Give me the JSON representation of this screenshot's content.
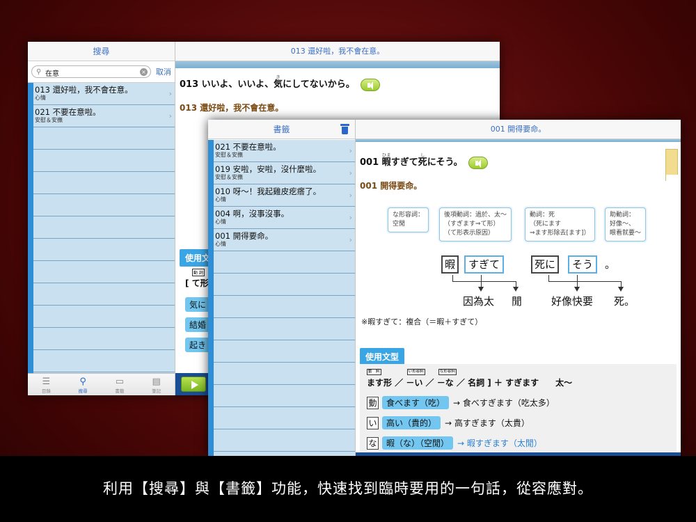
{
  "search_window": {
    "left_title": "搜尋",
    "search_value": "在意",
    "cancel_label": "取消",
    "results": [
      {
        "title": "013 還好啦，我不會在意。",
        "sub": "心情"
      },
      {
        "title": "021 不要在意啦。",
        "sub": "安慰＆安撫"
      }
    ],
    "tabs": [
      {
        "icon": "☰",
        "label": "目錄"
      },
      {
        "icon": "⚲",
        "label": "搜尋"
      },
      {
        "icon": "▭",
        "label": "書籤"
      },
      {
        "icon": "▤",
        "label": "筆記"
      }
    ],
    "right_title": "013 還好啦，我不會在意。",
    "jp_pre": "013 いいよ、いいよ、",
    "jp_kanji": "気",
    "jp_ruby": "き",
    "jp_post": "にしてないから。",
    "cn_line": "013 還好啦，我不會在意。",
    "pattern_partial": "使用文",
    "tag_partial": "動 詞",
    "formula_partial": "[ て形",
    "examples_partial": [
      "気に",
      "結婚",
      "起き"
    ]
  },
  "bookmark_window": {
    "left_title": "書籤",
    "items": [
      {
        "title": "021 不要在意啦。",
        "sub": "安慰＆安撫"
      },
      {
        "title": "019 安啦，安啦，沒什麼啦。",
        "sub": "安慰＆安撫"
      },
      {
        "title": "010 呀～！我起雞皮疙瘩了。",
        "sub": "心情"
      },
      {
        "title": "004 啊，沒事沒事。",
        "sub": "心情"
      },
      {
        "title": "001 開得要命。",
        "sub": "心情"
      }
    ],
    "right_title": "001 開得要命。",
    "jp_pre": "001 ",
    "jp_k1": "暇",
    "jp_r1": "ひま",
    "jp_mid": "すぎて",
    "jp_k2": "死",
    "jp_r2": "し",
    "jp_post": "にそう。",
    "cn_line": "001 開得要命。",
    "bubbles": [
      {
        "l1": "な形容詞：",
        "l2": "空閒",
        "l3": ""
      },
      {
        "l1": "後項動詞：過於、太～",
        "l2": "（すぎます⇒て形）",
        "l3": "（て形表示原因）"
      },
      {
        "l1": "動詞：死",
        "l2": "（死にます",
        "l3": "⇒ます形除去[ます]）"
      },
      {
        "l1": "助動詞：",
        "l2": "好像～、",
        "l3": "眼看就要～"
      }
    ],
    "words": [
      "暇",
      "すぎて",
      "死に",
      "そう",
      "。"
    ],
    "meanings": [
      "因為太",
      "閒",
      "好像快要",
      "死。"
    ],
    "note": "※暇すぎて：複合（＝暇＋すぎて）",
    "pattern_title": "使用文型",
    "tags": [
      "動　詞",
      "い形容詞",
      "な形容詞"
    ],
    "formula": "ます形 ／ －い ／ －な ／ 名詞 ] ＋ すぎます　　太～",
    "examples": [
      {
        "box": "動",
        "pill": "食べます（吃）",
        "ruby": "た",
        "result": "→ 食べすぎます（吃太多）"
      },
      {
        "box": "い",
        "pill": "高い（貴的）",
        "ruby": "たか",
        "result": "→ 高すぎます（太貴）"
      },
      {
        "box": "な",
        "pill": "暇（な）（空閒）",
        "ruby": "ひま",
        "result": "→ 暇すぎます（太閒）"
      }
    ]
  },
  "caption": "利用【搜尋】與【書籤】功能，快速找到臨時要用的一句話，從容應對。"
}
